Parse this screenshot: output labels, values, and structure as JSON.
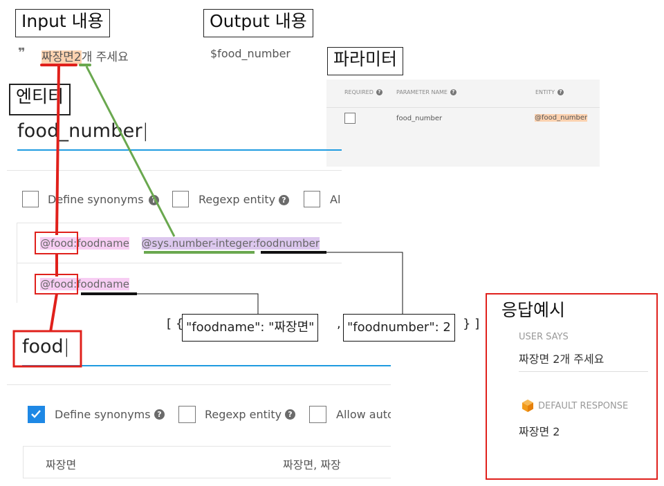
{
  "labels": {
    "input": "Input 내용",
    "output": "Output 내용",
    "parameters": "파라미터",
    "entity": "엔티티",
    "response_example": "응답예시"
  },
  "user_says": {
    "quote_icon": "format-quote-icon",
    "food": "짜장면",
    "number": "2",
    "rest": "개 주세요"
  },
  "output_value": "$food_number",
  "parameter_table": {
    "headers": [
      "REQUIRED",
      "PARAMETER NAME",
      "ENTITY"
    ],
    "row": {
      "name": "food_number",
      "entity": "@food_number",
      "required": false
    }
  },
  "entity_food_number": {
    "name": "food_number",
    "options": [
      "Define synonyms",
      "Regexp entity",
      "Al"
    ],
    "row1": {
      "entity": "@food",
      "alias": "foodname",
      "sys": "@sys.number-integer",
      "sys_alias": "foodnumber",
      "separator": ":"
    },
    "row2": {
      "entity": "@food",
      "alias": "foodname",
      "separator": ":"
    }
  },
  "entity_food": {
    "name": "food",
    "options": [
      "Define synonyms",
      "Regexp entity",
      "Allow auto"
    ],
    "define_synonyms_checked": true,
    "row": {
      "value": "짜장면",
      "synonyms": "짜장면, 짜장"
    }
  },
  "json_result": {
    "open": "[ {",
    "part1": "\"foodname\": \"짜장면\"",
    "comma": ",",
    "part2": "\"foodnumber\": 2",
    "close": "} ]"
  },
  "response_panel": {
    "user_says_header": "USER SAYS",
    "user_says_text": "짜장면 2개 주세요",
    "default_response_header": "DEFAULT RESPONSE",
    "default_response_text": "짜장면 2",
    "response_icon": "cube-icon"
  },
  "colors": {
    "red": "#e0201b",
    "green": "#6aa84f",
    "blue_underline": "#1e9be0",
    "checkbox_blue": "#1e88e5",
    "highlight_orange": "#fcd2b0",
    "highlight_pink": "#f7cdf3",
    "highlight_purple": "#dcc7ee"
  }
}
